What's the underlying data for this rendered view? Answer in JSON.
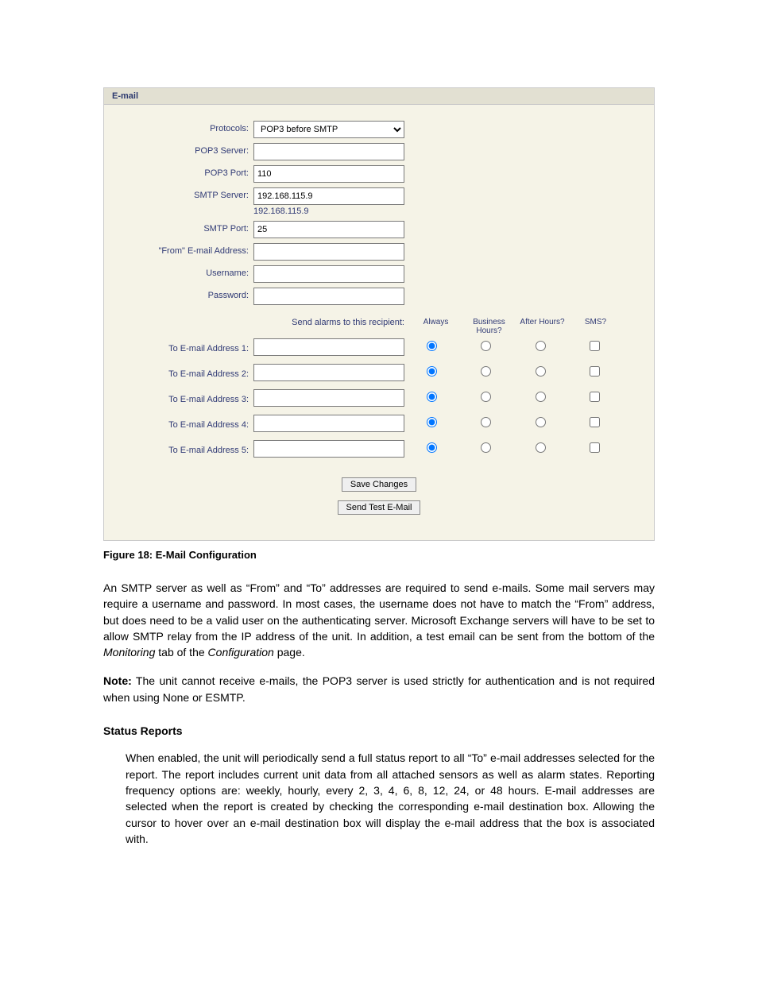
{
  "panel": {
    "title": "E-mail",
    "fields": {
      "protocols": {
        "label": "Protocols:",
        "value": "POP3 before SMTP"
      },
      "pop3_server": {
        "label": "POP3 Server:",
        "value": ""
      },
      "pop3_port": {
        "label": "POP3 Port:",
        "value": "110"
      },
      "smtp_server": {
        "label": "SMTP Server:",
        "value": "192.168.115.9",
        "note": "192.168.115.9"
      },
      "smtp_port": {
        "label": "SMTP Port:",
        "value": "25"
      },
      "from_addr": {
        "label": "\"From\" E-mail Address:",
        "value": ""
      },
      "username": {
        "label": "Username:",
        "value": ""
      },
      "password": {
        "label": "Password:",
        "value": ""
      }
    },
    "recipients": {
      "heading": "Send alarms to this recipient:",
      "cols": {
        "always": "Always",
        "business": "Business Hours?",
        "after": "After Hours?",
        "sms": "SMS?"
      },
      "rows": [
        {
          "label": "To E-mail Address 1:",
          "value": "",
          "always": true,
          "business": false,
          "after": false,
          "sms": false
        },
        {
          "label": "To E-mail Address 2:",
          "value": "",
          "always": true,
          "business": false,
          "after": false,
          "sms": false
        },
        {
          "label": "To E-mail Address 3:",
          "value": "",
          "always": true,
          "business": false,
          "after": false,
          "sms": false
        },
        {
          "label": "To E-mail Address 4:",
          "value": "",
          "always": true,
          "business": false,
          "after": false,
          "sms": false
        },
        {
          "label": "To E-mail Address 5:",
          "value": "",
          "always": true,
          "business": false,
          "after": false,
          "sms": false
        }
      ]
    },
    "buttons": {
      "save": "Save Changes",
      "test": "Send Test E-Mail"
    }
  },
  "caption": "Figure 18: E-Mail Configuration",
  "text": {
    "p1a": "An SMTP server as well as “From” and “To” addresses are required to send e-mails.  Some mail servers may require a username and password.  In most cases, the username does not have to match the “From” address, but does need to be a valid user on the authenticating server. Microsoft Exchange servers will have to be set to allow SMTP relay from the IP address of the unit. In addition, a test email can be sent from the bottom of the ",
    "p1_italic1": "Monitoring",
    "p1b": " tab of the ",
    "p1_italic2": "Configuration",
    "p1c": " page.",
    "note_label": "Note:",
    "note_body": " The unit cannot receive e-mails, the POP3 server is used strictly for authentication and is not required when using None or ESMTP.",
    "section_title": "Status Reports",
    "p2": "When enabled, the unit will periodically send a full status report to all “To” e-mail addresses selected for the report.  The report includes current unit data from all attached sensors as well as alarm states.  Reporting frequency options are: weekly, hourly, every 2, 3, 4, 6, 8, 12, 24, or 48 hours.  E-mail addresses are selected when the report is created by checking the corresponding e-mail destination box.  Allowing the cursor to hover over an e-mail destination box will display the e-mail address that the box is associated with."
  }
}
